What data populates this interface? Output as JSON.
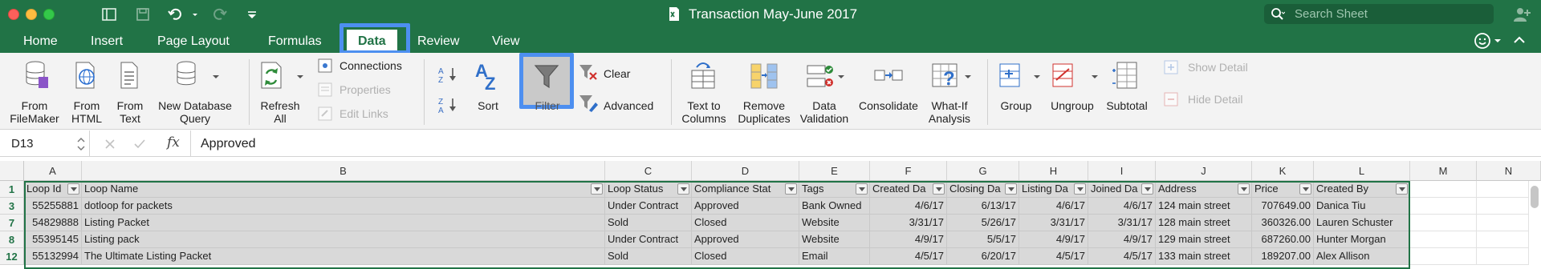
{
  "window": {
    "title": "Transaction May-June 2017",
    "search_placeholder": "Search Sheet"
  },
  "tabs": [
    "Home",
    "Insert",
    "Page Layout",
    "Formulas",
    "Data",
    "Review",
    "View"
  ],
  "active_tab": "Data",
  "ribbon": {
    "from_filemaker": [
      "From",
      "FileMaker"
    ],
    "from_html": [
      "From",
      "HTML"
    ],
    "from_text": [
      "From",
      "Text"
    ],
    "new_db_query": [
      "New Database",
      "Query"
    ],
    "refresh_all": [
      "Refresh",
      "All"
    ],
    "connections": "Connections",
    "properties": "Properties",
    "edit_links": "Edit Links",
    "sort": "Sort",
    "filter": "Filter",
    "clear": "Clear",
    "advanced": "Advanced",
    "text_to_columns": [
      "Text to",
      "Columns"
    ],
    "remove_duplicates": [
      "Remove",
      "Duplicates"
    ],
    "data_validation": [
      "Data",
      "Validation"
    ],
    "consolidate": "Consolidate",
    "what_if": [
      "What-If",
      "Analysis"
    ],
    "group": "Group",
    "ungroup": "Ungroup",
    "subtotal": "Subtotal",
    "show_detail": "Show Detail",
    "hide_detail": "Hide Detail"
  },
  "formula_bar": {
    "name_box": "D13",
    "fx": "fx",
    "value": "Approved"
  },
  "grid": {
    "columns": [
      "A",
      "B",
      "C",
      "D",
      "E",
      "F",
      "G",
      "H",
      "I",
      "J",
      "K",
      "L",
      "M",
      "N"
    ],
    "row_numbers": [
      "1",
      "3",
      "7",
      "8",
      "12"
    ],
    "headers": [
      "Loop Id",
      "Loop Name",
      "Loop Status",
      "Compliance Stat",
      "Tags",
      "Created Da",
      "Closing Da",
      "Listing Da",
      "Joined Da",
      "Address",
      "Price",
      "Created By"
    ],
    "rows": [
      [
        "55255881",
        "dotloop for packets",
        "Under Contract",
        "Approved",
        "Bank Owned",
        "4/6/17",
        "6/13/17",
        "4/6/17",
        "4/6/17",
        "124 main street",
        "707649.00",
        "Danica Tiu"
      ],
      [
        "54829888",
        "Listing Packet",
        "Sold",
        "Closed",
        "Website",
        "3/31/17",
        "5/26/17",
        "3/31/17",
        "3/31/17",
        "128 main street",
        "360326.00",
        "Lauren Schuster"
      ],
      [
        "55395145",
        "Listing pack",
        "Under Contract",
        "Approved",
        "Website",
        "4/9/17",
        "5/5/17",
        "4/9/17",
        "4/9/17",
        "129 main street",
        "687260.00",
        "Hunter Morgan"
      ],
      [
        "55132994",
        "The Ultimate Listing Packet",
        "Sold",
        "Closed",
        "Email",
        "4/5/17",
        "6/20/17",
        "4/5/17",
        "4/5/17",
        "133 main street",
        "189207.00",
        "Alex Allison"
      ]
    ]
  },
  "colors": {
    "excel_green": "#217346",
    "highlight_blue": "#4d8ff0",
    "cell_gray": "#d9d9d9"
  }
}
